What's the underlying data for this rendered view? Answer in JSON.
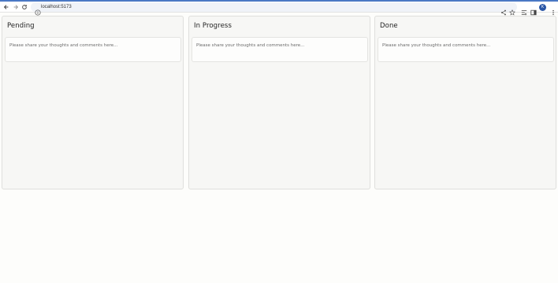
{
  "browser": {
    "url": "localhost:5173",
    "avatar_letter": "K",
    "icons": [
      "back-icon",
      "forward-icon",
      "reload-icon",
      "info-icon",
      "share-icon",
      "star-icon",
      "reading-list-icon",
      "side-panel-icon",
      "menu-icon"
    ]
  },
  "board": {
    "columns": [
      {
        "title": "Pending",
        "placeholder": "Please share your thoughts and comments here..."
      },
      {
        "title": "In Progress",
        "placeholder": "Please share your thoughts and comments here..."
      },
      {
        "title": "Done",
        "placeholder": "Please share your thoughts and comments here..."
      }
    ]
  },
  "colors": {
    "accent": "#4a78c4",
    "avatar": "#2b57a6",
    "column_bg": "#f7f7f5",
    "page_bg": "#fdfdfb"
  }
}
